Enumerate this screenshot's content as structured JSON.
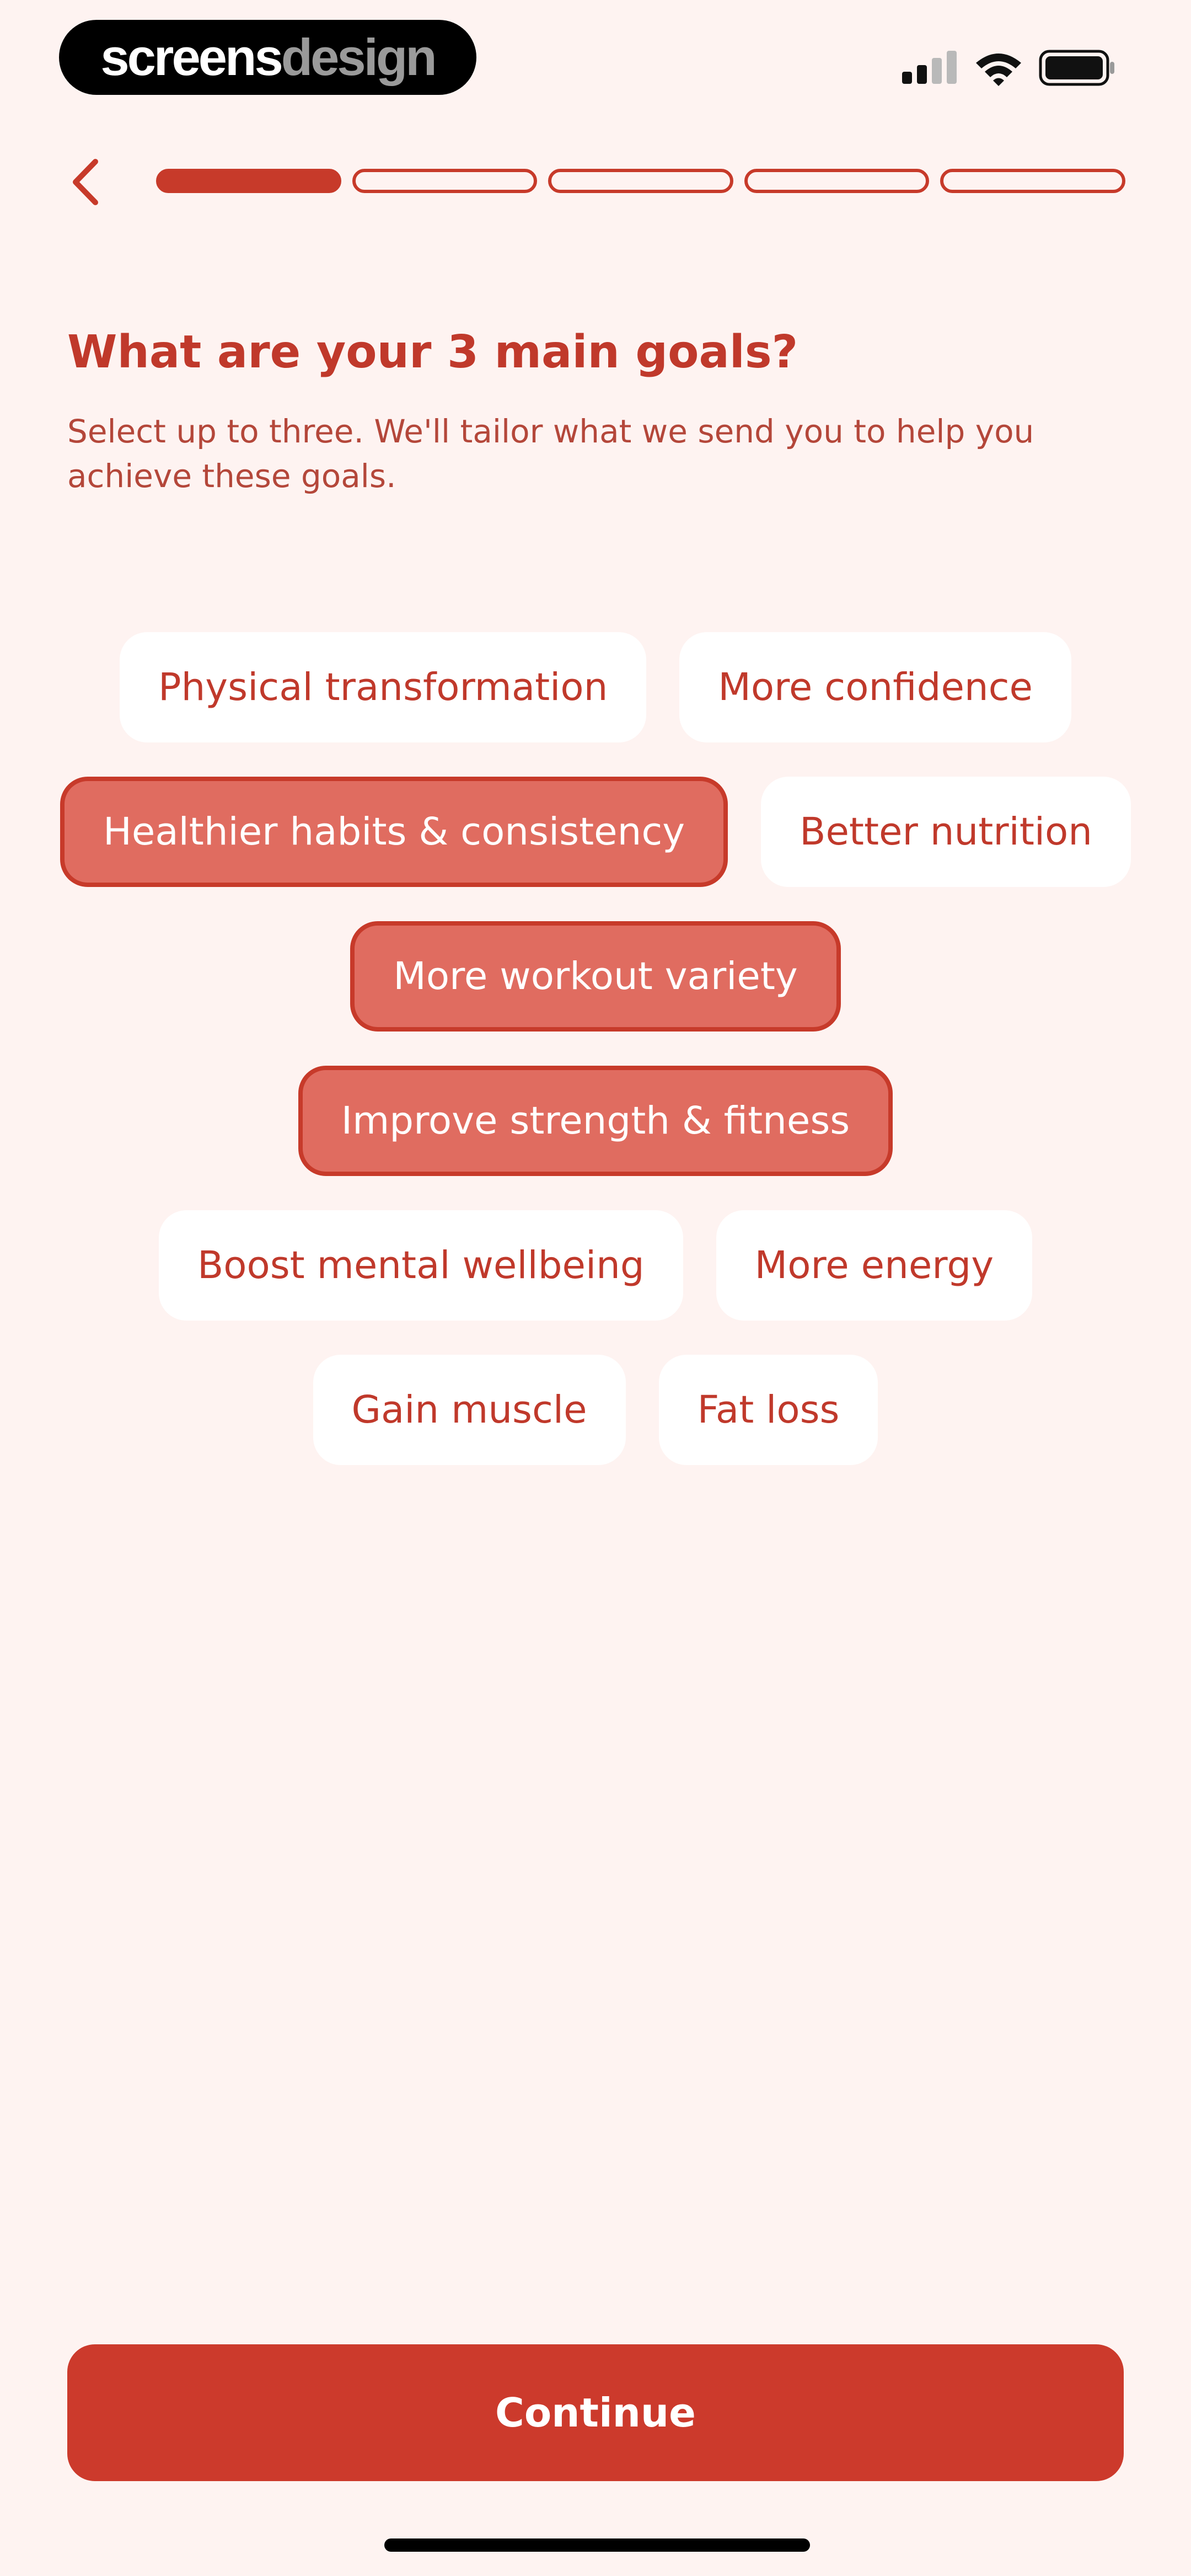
{
  "status_bar": {
    "brand_primary": "screens",
    "brand_secondary": "design",
    "icons": [
      "signal-icon",
      "wifi-icon",
      "battery-icon"
    ]
  },
  "nav": {
    "back_icon": "chevron-left-icon",
    "progress": {
      "total_steps": 5,
      "current_step": 1
    }
  },
  "content": {
    "title": "What are your 3 main goals?",
    "subtitle": "Select up to three. We'll tailor what we send you to help you achieve these goals."
  },
  "goals": [
    {
      "label": "Physical transformation",
      "selected": false
    },
    {
      "label": "More confidence",
      "selected": false
    },
    {
      "label": "Healthier habits & consistency",
      "selected": true
    },
    {
      "label": "Better nutrition",
      "selected": false
    },
    {
      "label": "More workout variety",
      "selected": true
    },
    {
      "label": "Improve strength & fitness",
      "selected": true
    },
    {
      "label": "Boost mental wellbeing",
      "selected": false
    },
    {
      "label": "More energy",
      "selected": false
    },
    {
      "label": "Gain muscle",
      "selected": false
    },
    {
      "label": "Fat loss",
      "selected": false
    }
  ],
  "footer": {
    "continue_label": "Continue"
  },
  "colors": {
    "background": "#FEF3F1",
    "accent": "#C73A2A",
    "selected_chip_fill": "#E06C60",
    "chip_fill": "#FFFFFF",
    "text_accent": "#C0392B"
  }
}
